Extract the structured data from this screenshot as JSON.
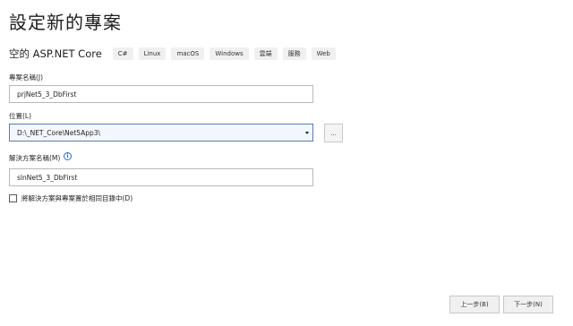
{
  "page": {
    "title": "設定新的專案"
  },
  "template": {
    "name": "空的 ASP.NET Core",
    "tags": [
      "C#",
      "Linux",
      "macOS",
      "Windows",
      "雲端",
      "服務",
      "Web"
    ]
  },
  "project_name": {
    "label": "專案名稱(J)",
    "value": "prjNet5_3_DbFirst"
  },
  "location": {
    "label": "位置(L)",
    "value": "D:\\_NET_Core\\Net5App3\\",
    "browse_label": "..."
  },
  "solution_name": {
    "label": "解決方案名稱(M)",
    "info_icon": "info-icon",
    "value": "slnNet5_3_DbFirst"
  },
  "same_directory": {
    "label": "將解決方案與專案置於相同目錄中(D)",
    "checked": false
  },
  "navigation": {
    "back_label": "上一步(B)",
    "next_label": "下一步(N)"
  }
}
